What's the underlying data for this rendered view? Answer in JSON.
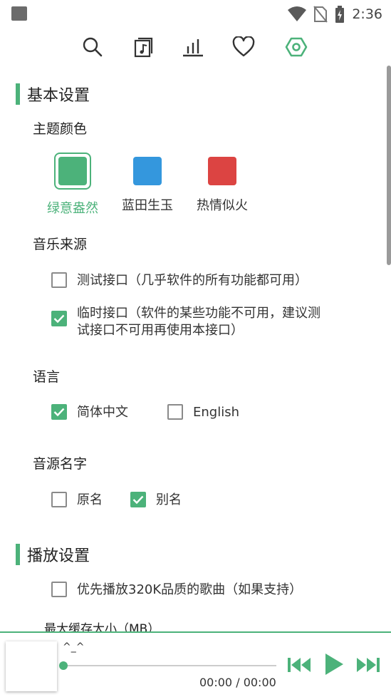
{
  "status_bar": {
    "time": "2:36"
  },
  "nav": {
    "icons": [
      "search-icon",
      "music-file-icon",
      "chart-icon",
      "heart-icon",
      "settings-icon"
    ],
    "active": "settings-icon"
  },
  "basic_settings": {
    "title": "基本设置",
    "theme": {
      "label": "主题颜色",
      "options": [
        {
          "label": "绿意盎然",
          "color": "#4cb27a",
          "selected": true
        },
        {
          "label": "蓝田生玉",
          "color": "#3497dd",
          "selected": false
        },
        {
          "label": "热情似火",
          "color": "#dc4442",
          "selected": false
        }
      ]
    },
    "music_source": {
      "label": "音乐来源",
      "options": [
        {
          "label": "测试接口（几乎软件的所有功能都可用）",
          "checked": false
        },
        {
          "label_line1": "临时接口（软件的某些功能不可用，建议测",
          "label_line2": "试接口不可用再使用本接口）",
          "checked": true
        }
      ]
    },
    "language": {
      "label": "语言",
      "options": [
        {
          "label": "简体中文",
          "checked": true
        },
        {
          "label": "English",
          "checked": false
        }
      ]
    },
    "source_name": {
      "label": "音源名字",
      "options": [
        {
          "label": "原名",
          "checked": false
        },
        {
          "label": "别名",
          "checked": true
        }
      ]
    }
  },
  "play_settings": {
    "title": "播放设置",
    "prefer_320k": {
      "label": "优先播放320K品质的歌曲（如果支持）",
      "checked": false
    },
    "max_cache_label": "最大缓存大小（MB）"
  },
  "player": {
    "song_title": "^_^",
    "current_time": "00:00",
    "separator": "/",
    "total_time": "00:00",
    "progress": 0,
    "accent": "#4cb27a"
  }
}
